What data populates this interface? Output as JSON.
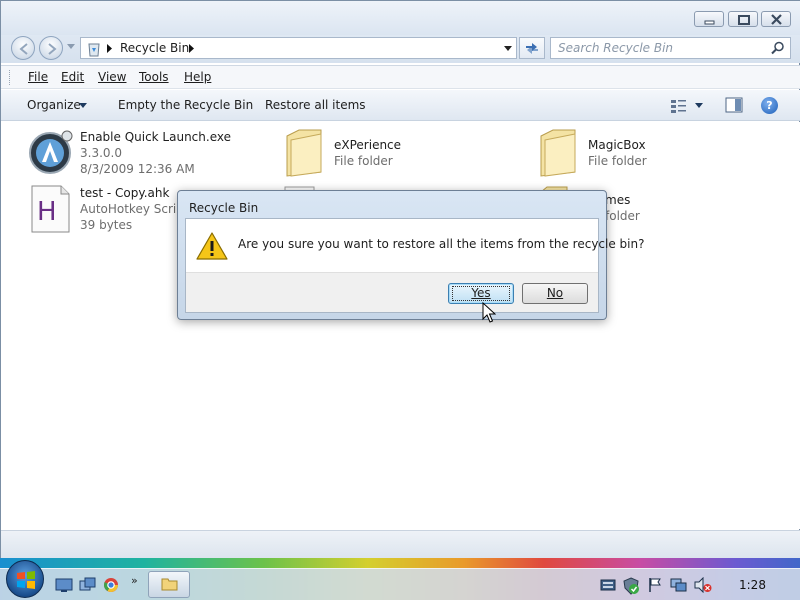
{
  "window": {
    "title_buttons": [
      "minimize-icon",
      "restore-icon",
      "close-icon"
    ]
  },
  "address": {
    "location": "Recycle Bin",
    "search_placeholder": "Search Recycle Bin"
  },
  "menu": {
    "file": "File",
    "edit": "Edit",
    "view": "View",
    "tools": "Tools",
    "help": "Help"
  },
  "commands": {
    "organize": "Organize",
    "empty": "Empty the Recycle Bin",
    "restore_all": "Restore all items"
  },
  "files": [
    {
      "name": "Enable Quick Launch.exe",
      "detail": "3.3.0.0",
      "detail2": "8/3/2009 12:36 AM",
      "icon": "app-icon"
    },
    {
      "name": "test - Copy.ahk",
      "detail": "AutoHotkey Script",
      "detail2": "39 bytes",
      "icon": "ahk-script-icon"
    },
    {
      "name": "eXPerience",
      "detail": "File folder",
      "icon": "folder-icon"
    },
    {
      "name": "MagicBox",
      "detail": "File folder",
      "icon": "folder-icon"
    },
    {
      "name": "mes",
      "detail": "folder",
      "icon": "folder-icon"
    }
  ],
  "dialog": {
    "title": "Recycle Bin",
    "message": "Are you sure you want to restore all the items from the recycle bin?",
    "yes": "Yes",
    "no": "No"
  },
  "taskbar": {
    "chevron": "»",
    "clock": "1:28"
  }
}
